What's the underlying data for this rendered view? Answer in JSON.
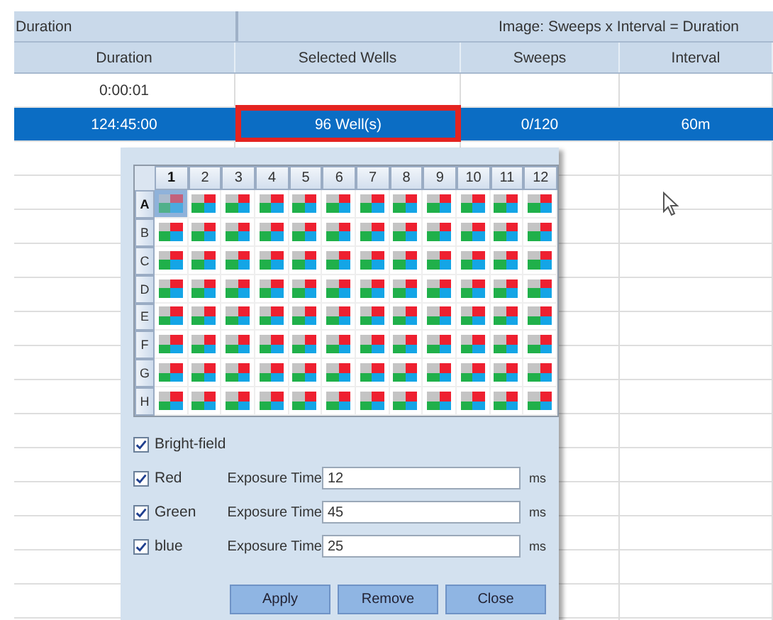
{
  "table": {
    "groups": [
      {
        "label": "Duration"
      },
      {
        "label": "Image: Sweeps x Interval = Duration"
      }
    ],
    "columns": [
      "Duration",
      "Selected Wells",
      "Sweeps",
      "Interval"
    ],
    "rows": [
      {
        "selected": false,
        "cells": [
          {
            "text": "0:00:01",
            "outlined": false
          },
          {
            "outlined": false
          },
          {
            "outlined": false
          },
          {
            "outlined": false
          }
        ]
      },
      {
        "selected": true,
        "cells": [
          {
            "text": "124:45:00",
            "outlined": false
          },
          {
            "text": "96 Well(s)",
            "outlined": true
          },
          {
            "text": "0/120",
            "outlined": false
          },
          {
            "text": "60m",
            "outlined": false
          }
        ]
      }
    ]
  },
  "popup": {
    "plate": {
      "columns": [
        {
          "label": "1",
          "selected": true
        },
        {
          "label": "2",
          "selected": false
        },
        {
          "label": "3",
          "selected": false
        },
        {
          "label": "4",
          "selected": false
        },
        {
          "label": "5",
          "selected": false
        },
        {
          "label": "6",
          "selected": false
        },
        {
          "label": "7",
          "selected": false
        },
        {
          "label": "8",
          "selected": false
        },
        {
          "label": "9",
          "selected": false
        },
        {
          "label": "10",
          "selected": false
        },
        {
          "label": "11",
          "selected": false
        },
        {
          "label": "12",
          "selected": false
        }
      ],
      "rows": [
        {
          "label": "A",
          "selected": true,
          "wells": [
            {
              "selected": true
            },
            {
              "selected": false
            },
            {
              "selected": false
            },
            {
              "selected": false
            },
            {
              "selected": false
            },
            {
              "selected": false
            },
            {
              "selected": false
            },
            {
              "selected": false
            },
            {
              "selected": false
            },
            {
              "selected": false
            },
            {
              "selected": false
            },
            {
              "selected": false
            }
          ]
        },
        {
          "label": "B",
          "selected": false,
          "wells": [
            {
              "selected": false
            },
            {
              "selected": false
            },
            {
              "selected": false
            },
            {
              "selected": false
            },
            {
              "selected": false
            },
            {
              "selected": false
            },
            {
              "selected": false
            },
            {
              "selected": false
            },
            {
              "selected": false
            },
            {
              "selected": false
            },
            {
              "selected": false
            },
            {
              "selected": false
            }
          ]
        },
        {
          "label": "C",
          "selected": false,
          "wells": [
            {
              "selected": false
            },
            {
              "selected": false
            },
            {
              "selected": false
            },
            {
              "selected": false
            },
            {
              "selected": false
            },
            {
              "selected": false
            },
            {
              "selected": false
            },
            {
              "selected": false
            },
            {
              "selected": false
            },
            {
              "selected": false
            },
            {
              "selected": false
            },
            {
              "selected": false
            }
          ]
        },
        {
          "label": "D",
          "selected": false,
          "wells": [
            {
              "selected": false
            },
            {
              "selected": false
            },
            {
              "selected": false
            },
            {
              "selected": false
            },
            {
              "selected": false
            },
            {
              "selected": false
            },
            {
              "selected": false
            },
            {
              "selected": false
            },
            {
              "selected": false
            },
            {
              "selected": false
            },
            {
              "selected": false
            },
            {
              "selected": false
            }
          ]
        },
        {
          "label": "E",
          "selected": false,
          "wells": [
            {
              "selected": false
            },
            {
              "selected": false
            },
            {
              "selected": false
            },
            {
              "selected": false
            },
            {
              "selected": false
            },
            {
              "selected": false
            },
            {
              "selected": false
            },
            {
              "selected": false
            },
            {
              "selected": false
            },
            {
              "selected": false
            },
            {
              "selected": false
            },
            {
              "selected": false
            }
          ]
        },
        {
          "label": "F",
          "selected": false,
          "wells": [
            {
              "selected": false
            },
            {
              "selected": false
            },
            {
              "selected": false
            },
            {
              "selected": false
            },
            {
              "selected": false
            },
            {
              "selected": false
            },
            {
              "selected": false
            },
            {
              "selected": false
            },
            {
              "selected": false
            },
            {
              "selected": false
            },
            {
              "selected": false
            },
            {
              "selected": false
            }
          ]
        },
        {
          "label": "G",
          "selected": false,
          "wells": [
            {
              "selected": false
            },
            {
              "selected": false
            },
            {
              "selected": false
            },
            {
              "selected": false
            },
            {
              "selected": false
            },
            {
              "selected": false
            },
            {
              "selected": false
            },
            {
              "selected": false
            },
            {
              "selected": false
            },
            {
              "selected": false
            },
            {
              "selected": false
            },
            {
              "selected": false
            }
          ]
        },
        {
          "label": "H",
          "selected": false,
          "wells": [
            {
              "selected": false
            },
            {
              "selected": false
            },
            {
              "selected": false
            },
            {
              "selected": false
            },
            {
              "selected": false
            },
            {
              "selected": false
            },
            {
              "selected": false
            },
            {
              "selected": false
            },
            {
              "selected": false
            },
            {
              "selected": false
            },
            {
              "selected": false
            },
            {
              "selected": false
            }
          ]
        }
      ]
    },
    "channels": [
      {
        "kind": "plain",
        "label": "Bright-field",
        "checked": true
      },
      {
        "kind": "exposure",
        "label": "Red",
        "checked": true,
        "exposure_label": "Exposure Time",
        "value": "12",
        "unit": "ms"
      },
      {
        "kind": "exposure",
        "label": "Green",
        "checked": true,
        "exposure_label": "Exposure Time",
        "value": "45",
        "unit": "ms"
      },
      {
        "kind": "exposure",
        "label": "blue",
        "checked": true,
        "exposure_label": "Exposure Time",
        "value": "25",
        "unit": "ms"
      }
    ],
    "buttons": [
      "Apply",
      "Remove",
      "Close"
    ]
  }
}
